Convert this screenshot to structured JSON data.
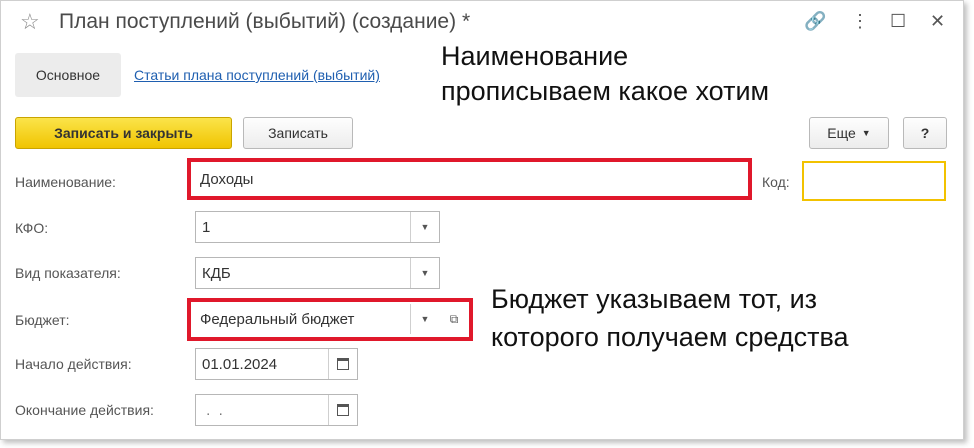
{
  "window": {
    "title": "План поступлений (выбытий) (создание) *",
    "controls": {
      "link": "🔗",
      "more": "⋮",
      "maximize": "☐",
      "close": "✕"
    }
  },
  "tabs": {
    "main": "Основное",
    "link": "Статьи плана поступлений (выбытий)"
  },
  "toolbar": {
    "save_close": "Записать и закрыть",
    "save": "Записать",
    "more": "Еще",
    "help": "?"
  },
  "form": {
    "name_label": "Наименование:",
    "name_value": "Доходы",
    "code_label": "Код:",
    "code_value": "",
    "kfo_label": "КФО:",
    "kfo_value": "1",
    "indicator_label": "Вид показателя:",
    "indicator_value": "КДБ",
    "budget_label": "Бюджет:",
    "budget_value": "Федеральный бюджет",
    "start_label": "Начало действия:",
    "start_value": "01.01.2024",
    "end_label": "Окончание действия:",
    "end_value": " .  . "
  },
  "annotations": {
    "name_note_line1": "Наименование",
    "name_note_line2": "прописываем какое хотим",
    "budget_note_line1": "Бюджет указываем тот, из",
    "budget_note_line2": "которого получаем средства"
  },
  "colors": {
    "highlight": "#e0182b",
    "primary_button": "#f5cf14",
    "link": "#1f5fb0",
    "code_field_border": "#f2c200"
  }
}
